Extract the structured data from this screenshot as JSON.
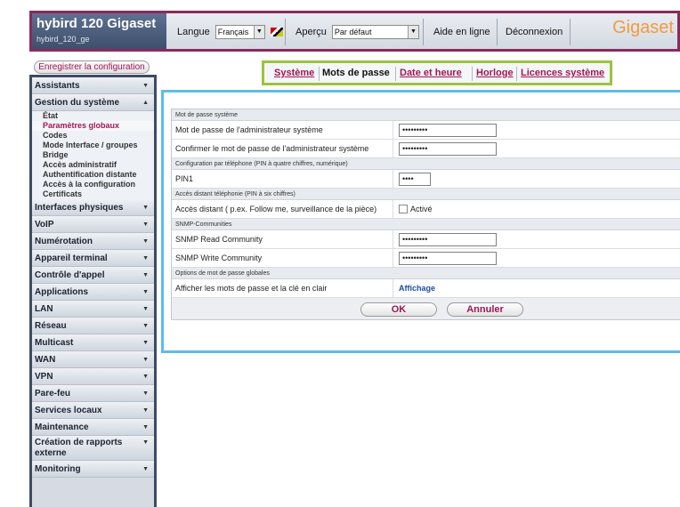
{
  "header": {
    "brand_title": "hybird 120 Gigaset",
    "brand_subtitle": "hybird_120_ge",
    "language_label": "Langue",
    "language_value": "Français",
    "preview_label": "Aperçu",
    "preview_value": "Par défaut",
    "help_label": "Aide en ligne",
    "logout_label": "Déconnexion",
    "logo_text": "Gigaset",
    "accent_color": "#8a2a5e"
  },
  "save_button": "Enregistrer la configuration",
  "sidebar": {
    "items": [
      {
        "label": "Assistants",
        "expanded": false
      },
      {
        "label": "Gestion du système",
        "expanded": true,
        "children": [
          "État",
          "Paramètres globaux",
          "Codes",
          "Mode Interface / groupes Bridge",
          "Accès administratif",
          "Authentification distante",
          "Accès à la configuration",
          "Certificats"
        ],
        "active_child": "Paramètres globaux"
      },
      {
        "label": "Interfaces physiques",
        "expanded": false
      },
      {
        "label": "VoIP",
        "expanded": false
      },
      {
        "label": "Numérotation",
        "expanded": false
      },
      {
        "label": "Appareil terminal",
        "expanded": false
      },
      {
        "label": "Contrôle d'appel",
        "expanded": false
      },
      {
        "label": "Applications",
        "expanded": false
      },
      {
        "label": "LAN",
        "expanded": false
      },
      {
        "label": "Réseau",
        "expanded": false
      },
      {
        "label": "Multicast",
        "expanded": false
      },
      {
        "label": "WAN",
        "expanded": false
      },
      {
        "label": "VPN",
        "expanded": false
      },
      {
        "label": "Pare-feu",
        "expanded": false
      },
      {
        "label": "Services locaux",
        "expanded": false
      },
      {
        "label": "Maintenance",
        "expanded": false
      },
      {
        "label": "Création de rapports externe",
        "expanded": false
      },
      {
        "label": "Monitoring",
        "expanded": false
      }
    ]
  },
  "tabs": [
    "Système",
    "Mots de passe",
    "Date et heure",
    "Horloge",
    "Licences système"
  ],
  "active_tab": "Mots de passe",
  "form": {
    "sec_system": "Mot de passe système",
    "admin_pw_label": "Mot de passe de l'administrateur système",
    "admin_pw_value": "•••••••••",
    "confirm_pw_label": "Confirmer le mot de passe de l'administrateur système",
    "confirm_pw_value": "•••••••••",
    "sec_phone": "Configuration par téléphone (PIN à quatre chiffres, numérique)",
    "pin1_label": "PIN1",
    "pin1_value": "••••",
    "sec_remote": "Accès distant téléphonie (PIN à six chiffres)",
    "remote_label": "Accès distant ( p.ex. Follow me, surveillance de la pièce)",
    "remote_checkbox_label": "Activé",
    "sec_snmp": "SNMP-Communities",
    "snmp_read_label": "SNMP Read Community",
    "snmp_read_value": "•••••••••",
    "snmp_write_label": "SNMP Write Community",
    "snmp_write_value": "•••••••••",
    "sec_global": "Options de mot de passe globales",
    "show_pw_label": "Afficher les mots de passe et la clé en clair",
    "show_pw_link": "Affichage"
  },
  "buttons": {
    "ok": "OK",
    "cancel": "Annuler"
  }
}
